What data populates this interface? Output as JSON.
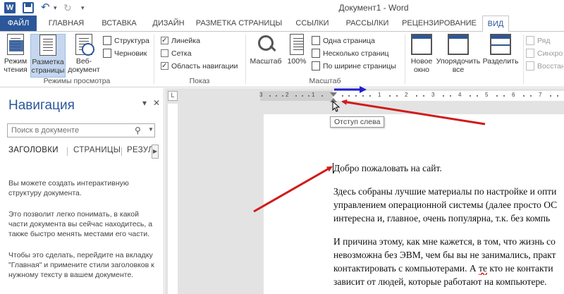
{
  "window": {
    "title": "Документ1 - Word"
  },
  "tabs": [
    {
      "label": "ФАЙЛ"
    },
    {
      "label": "ГЛАВНАЯ"
    },
    {
      "label": "ВСТАВКА"
    },
    {
      "label": "ДИЗАЙН"
    },
    {
      "label": "РАЗМЕТКА СТРАНИЦЫ"
    },
    {
      "label": "ССЫЛКИ"
    },
    {
      "label": "РАССЫЛКИ"
    },
    {
      "label": "РЕЦЕНЗИРОВАНИЕ"
    },
    {
      "label": "ВИД"
    }
  ],
  "ribbon": {
    "views": {
      "group_label": "Режимы просмотра",
      "read_mode_1": "Режим",
      "read_mode_2": "чтения",
      "print_layout_1": "Разметка",
      "print_layout_2": "страницы",
      "web_layout_1": "Веб-",
      "web_layout_2": "документ",
      "outline": "Структура",
      "draft": "Черновик"
    },
    "show": {
      "group_label": "Показ",
      "ruler": "Линейка",
      "ruler_checked": true,
      "gridlines": "Сетка",
      "gridlines_checked": false,
      "navigation": "Область навигации",
      "navigation_checked": true
    },
    "zoom": {
      "group_label": "Масштаб",
      "zoom": "Масштаб",
      "hundred": "100%",
      "one_page": "Одна страница",
      "multiple_pages": "Несколько страниц",
      "page_width": "По ширине страницы"
    },
    "window": {
      "new_window_1": "Новое",
      "new_window_2": "окно",
      "arrange_1": "Упорядочить",
      "arrange_2": "все",
      "split": "Разделить",
      "side_by_side": "Ряд",
      "sync": "Синхро",
      "reset": "Восстан"
    }
  },
  "navigation": {
    "title": "Навигация",
    "search_placeholder": "Поиск в документе",
    "tabs": [
      "ЗАГОЛОВКИ",
      "СТРАНИЦЫ",
      "РЕЗУЛЬ"
    ],
    "help_1": "Вы можете создать интерактивную структуру документа.",
    "help_2": "Это позволит легко понимать, в какой части документа вы сейчас находитесь, а также быстро менять местами его части.",
    "help_3": "Чтобы это сделать, перейдите на вкладку \"Главная\" и примените стили заголовков к нужному тексту в вашем документе."
  },
  "ruler": {
    "left_numbers": [
      "3",
      "2",
      "1"
    ],
    "right_numbers": [
      "1",
      "2",
      "3",
      "4",
      "5",
      "6",
      "7"
    ],
    "tooltip": "Отступ слева"
  },
  "document": {
    "p1": "Добро пожаловать на сайт.",
    "p2_l1": "Здесь собраны лучшие материалы по настройке и опти",
    "p2_l2": "управлением операционной системы (далее просто ОС",
    "p2_l3": "интересна и, главное, очень популярна, т.к. без компь",
    "p3_l1": "И причина этому, как мне кажется, в том, что жизнь со",
    "p3_l2": "невозможна без ЭВМ, чем бы вы не занимались, практ",
    "p3_l3_a": "контактировать с компьютерами. А ",
    "p3_l3_b": "те",
    "p3_l3_c": " кто не контакти",
    "p3_l4": "зависит от людей, которые работают на компьютере."
  },
  "colors": {
    "accent": "#2b579a",
    "annotation_red": "#d21a1a",
    "annotation_blue": "#1f1fd0"
  }
}
